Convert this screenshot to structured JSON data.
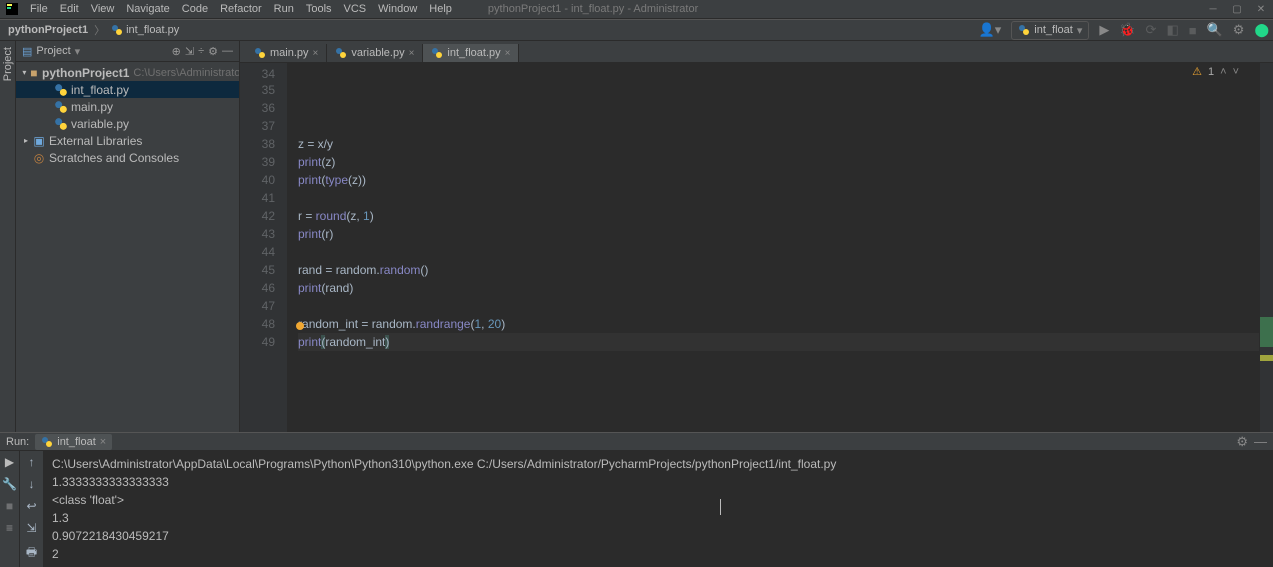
{
  "menubar": {
    "items": [
      "File",
      "Edit",
      "View",
      "Navigate",
      "Code",
      "Refactor",
      "Run",
      "Tools",
      "VCS",
      "Window",
      "Help"
    ],
    "context": "pythonProject1 - int_float.py - Administrator"
  },
  "breadcrumb": {
    "project": "pythonProject1",
    "file": "int_float.py"
  },
  "toolbar": {
    "run_config": "int_float"
  },
  "project_panel": {
    "title": "Project",
    "root": {
      "name": "pythonProject1",
      "path": "C:\\Users\\Administrator\\Pycha"
    },
    "files": [
      "int_float.py",
      "main.py",
      "variable.py"
    ],
    "external": "External Libraries",
    "scratches": "Scratches and Consoles"
  },
  "editor": {
    "tabs": [
      {
        "name": "main.py",
        "active": false
      },
      {
        "name": "variable.py",
        "active": false
      },
      {
        "name": "int_float.py",
        "active": true
      }
    ],
    "indicator_warnings": "1",
    "lines": [
      {
        "n": 34,
        "html": ""
      },
      {
        "n": 35,
        "html": "z = x/y"
      },
      {
        "n": 36,
        "html": "print(z)"
      },
      {
        "n": 37,
        "html": "print(type(z))"
      },
      {
        "n": 38,
        "html": ""
      },
      {
        "n": 39,
        "html": "r = round(z, 1)"
      },
      {
        "n": 40,
        "html": "print(r)"
      },
      {
        "n": 41,
        "html": ""
      },
      {
        "n": 42,
        "html": "rand = random.random()"
      },
      {
        "n": 43,
        "html": "print(rand)"
      },
      {
        "n": 44,
        "html": ""
      },
      {
        "n": 45,
        "html": "random_int = random.randrange(1, 20)"
      },
      {
        "n": 46,
        "html": "print(random_int)"
      },
      {
        "n": 47,
        "html": ""
      },
      {
        "n": 48,
        "html": ""
      },
      {
        "n": 49,
        "html": ""
      }
    ]
  },
  "run": {
    "label": "Run:",
    "tab": "int_float",
    "output": [
      "C:\\Users\\Administrator\\AppData\\Local\\Programs\\Python\\Python310\\python.exe C:/Users/Administrator/PycharmProjects/pythonProject1/int_float.py",
      "1.3333333333333333",
      "<class 'float'>",
      "1.3",
      "0.9072218430459217",
      "2"
    ]
  }
}
